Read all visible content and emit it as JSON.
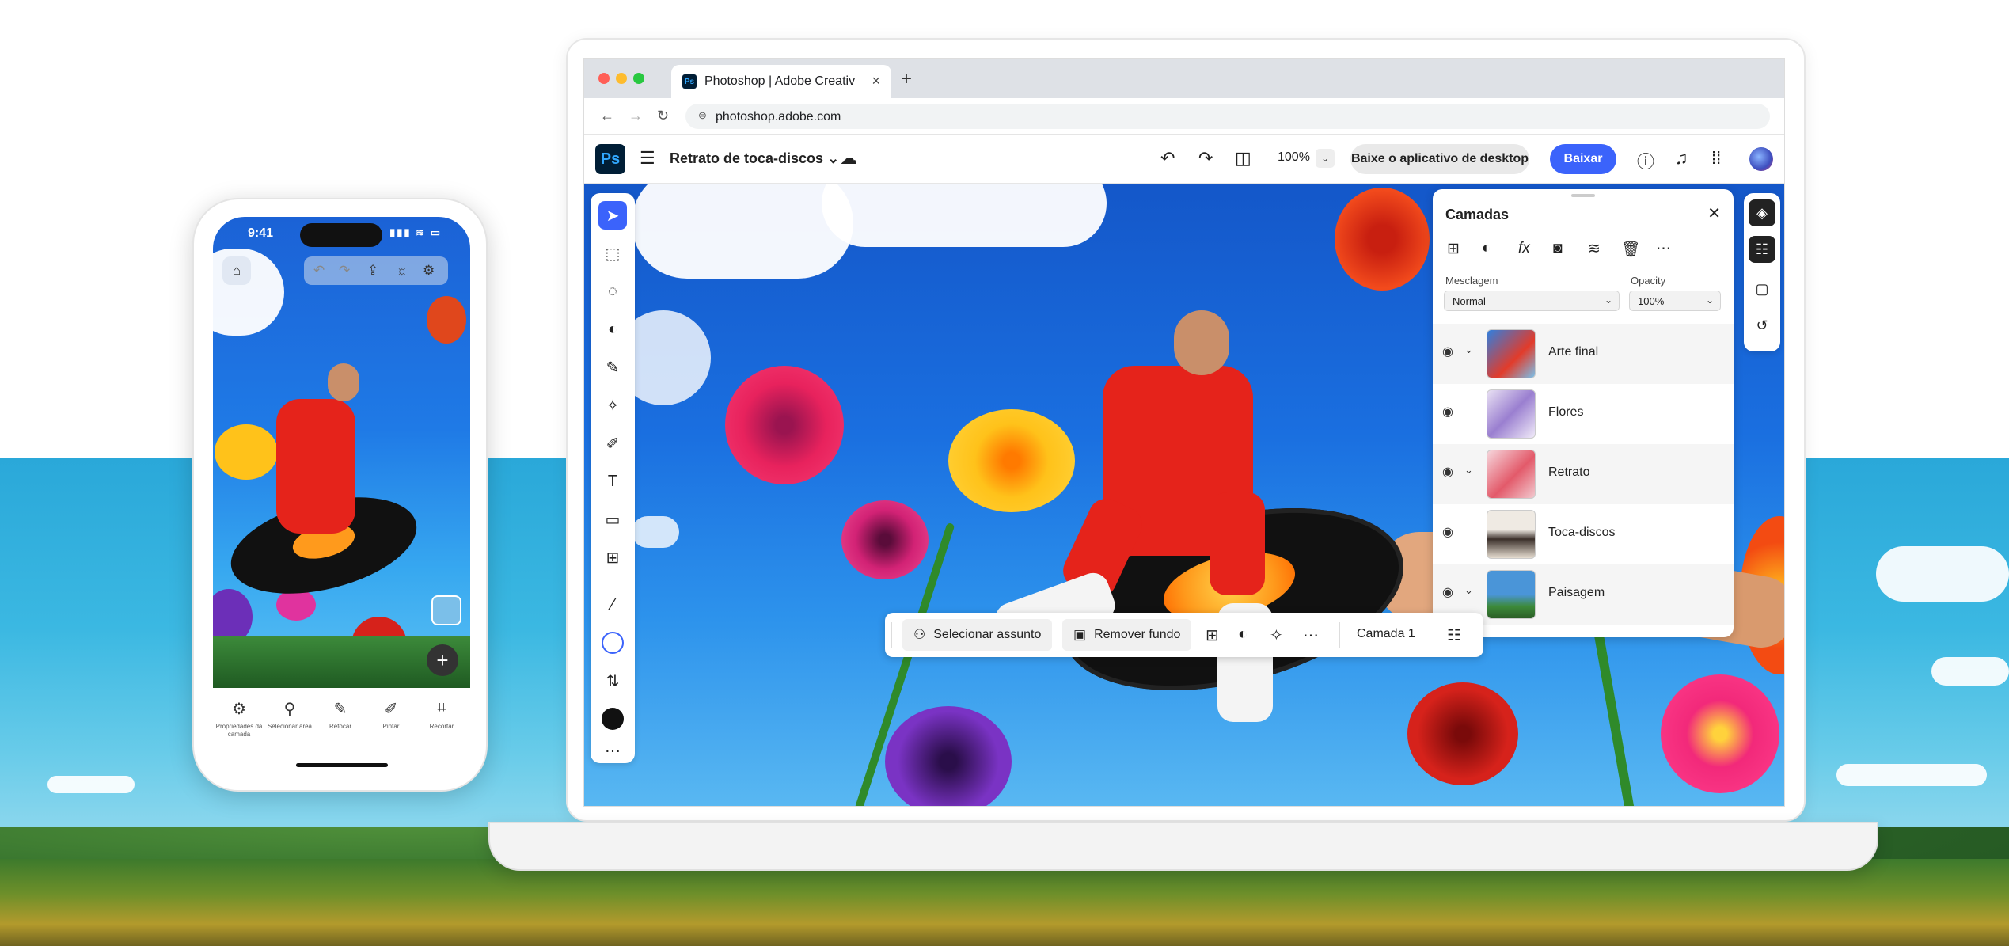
{
  "phone": {
    "time": "9:41",
    "signal": "▮▮▮ ≋ ▭",
    "toolbar": [
      {
        "icon": "⚙",
        "label": "Propriedades da camada"
      },
      {
        "icon": "⚲",
        "label": "Selecionar área"
      },
      {
        "icon": "✎",
        "label": "Retocar"
      },
      {
        "icon": "✐",
        "label": "Pintar"
      },
      {
        "icon": "⌗",
        "label": "Recortar"
      }
    ]
  },
  "browser": {
    "tab_title": "Photoshop | Adobe Creative C",
    "favicon": "Ps",
    "url": "photoshop.adobe.com",
    "dots": [
      "#ff5f57",
      "#febc2e",
      "#28c840"
    ]
  },
  "app": {
    "logo": "Ps",
    "document_title": "Retrato de toca-discos",
    "zoom": "100%",
    "desktop_button": "Baixe o aplicativo de desktop",
    "download_button": "Baixar",
    "accent": "#3b63fb"
  },
  "layers_panel": {
    "title": "Camadas",
    "blend_label": "Mesclagem",
    "blend_value": "Normal",
    "opacity_label": "Opacity",
    "opacity_value": "100%",
    "layers": [
      {
        "name": "Arte final",
        "has_children": true,
        "thumb": "#3b8fe0"
      },
      {
        "name": "Flores",
        "has_children": false,
        "thumb": "#b9a2d9"
      },
      {
        "name": "Retrato",
        "has_children": true,
        "thumb": "#e7a0a8"
      },
      {
        "name": "Toca-discos",
        "has_children": false,
        "thumb": "#c8bfb4"
      },
      {
        "name": "Paisagem",
        "has_children": true,
        "thumb": "#5aa0d6"
      }
    ]
  },
  "taskbar": {
    "select_subject": "Selecionar assunto",
    "remove_background": "Remover fundo",
    "layer_name": "Camada 1"
  }
}
